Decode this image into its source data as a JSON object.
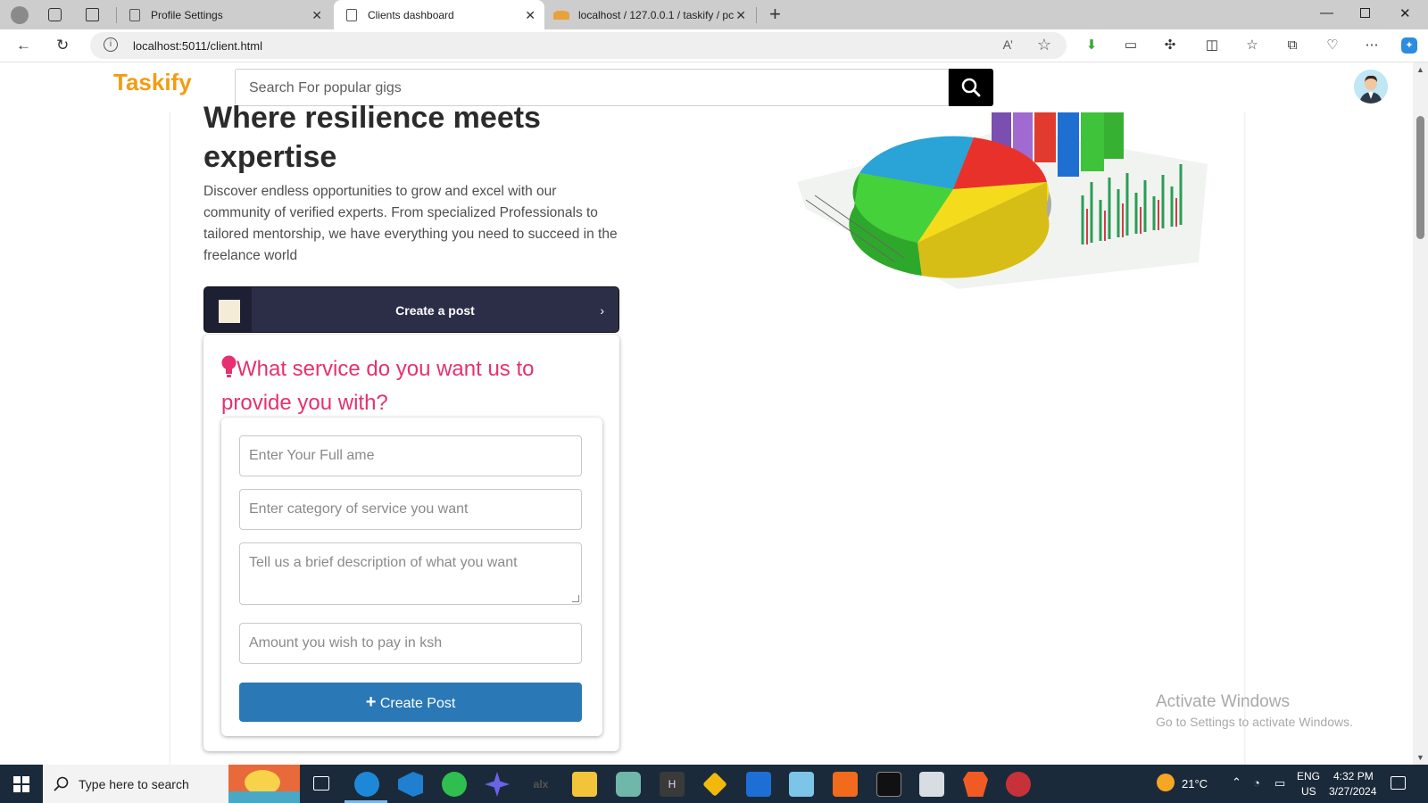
{
  "browser": {
    "tabs": [
      {
        "title": "Profile Settings"
      },
      {
        "title": "Clients dashboard"
      },
      {
        "title": "localhost / 127.0.0.1 / taskify / pc"
      }
    ],
    "url": "localhost:5011/client.html",
    "read_aloud_label": "A’"
  },
  "site": {
    "logo": "Taskify",
    "search_placeholder": "Search For popular gigs",
    "hero_title_line1": "Where resilience meets",
    "hero_title_line2": "expertise",
    "hero_text": "Discover endless opportunities to grow and excel with our community of verified experts. From specialized Professionals to tailored mentorship, we have everything you need to succeed in the freelance world",
    "create_post_bar": "Create a post",
    "form_question": "What service do you want us to provide you with?",
    "fields": {
      "name_placeholder": "Enter Your Full ame",
      "category_placeholder": "Enter category of service you want",
      "description_placeholder": "Tell us a brief description of what you want",
      "amount_placeholder": "Amount you wish to pay in ksh"
    },
    "create_button": "Create Post"
  },
  "watermark": {
    "line1": "Activate Windows",
    "line2": "Go to Settings to activate Windows."
  },
  "taskbar": {
    "search_text": "Type here to search",
    "temperature": "21°C",
    "language": "ENG",
    "region": "US",
    "time": "4:32 PM",
    "date": "3/27/2024"
  },
  "colors": {
    "logo": "#f39c12",
    "question": "#e5316f",
    "create_button": "#2a78b6",
    "post_bar": "#2c2e48"
  }
}
